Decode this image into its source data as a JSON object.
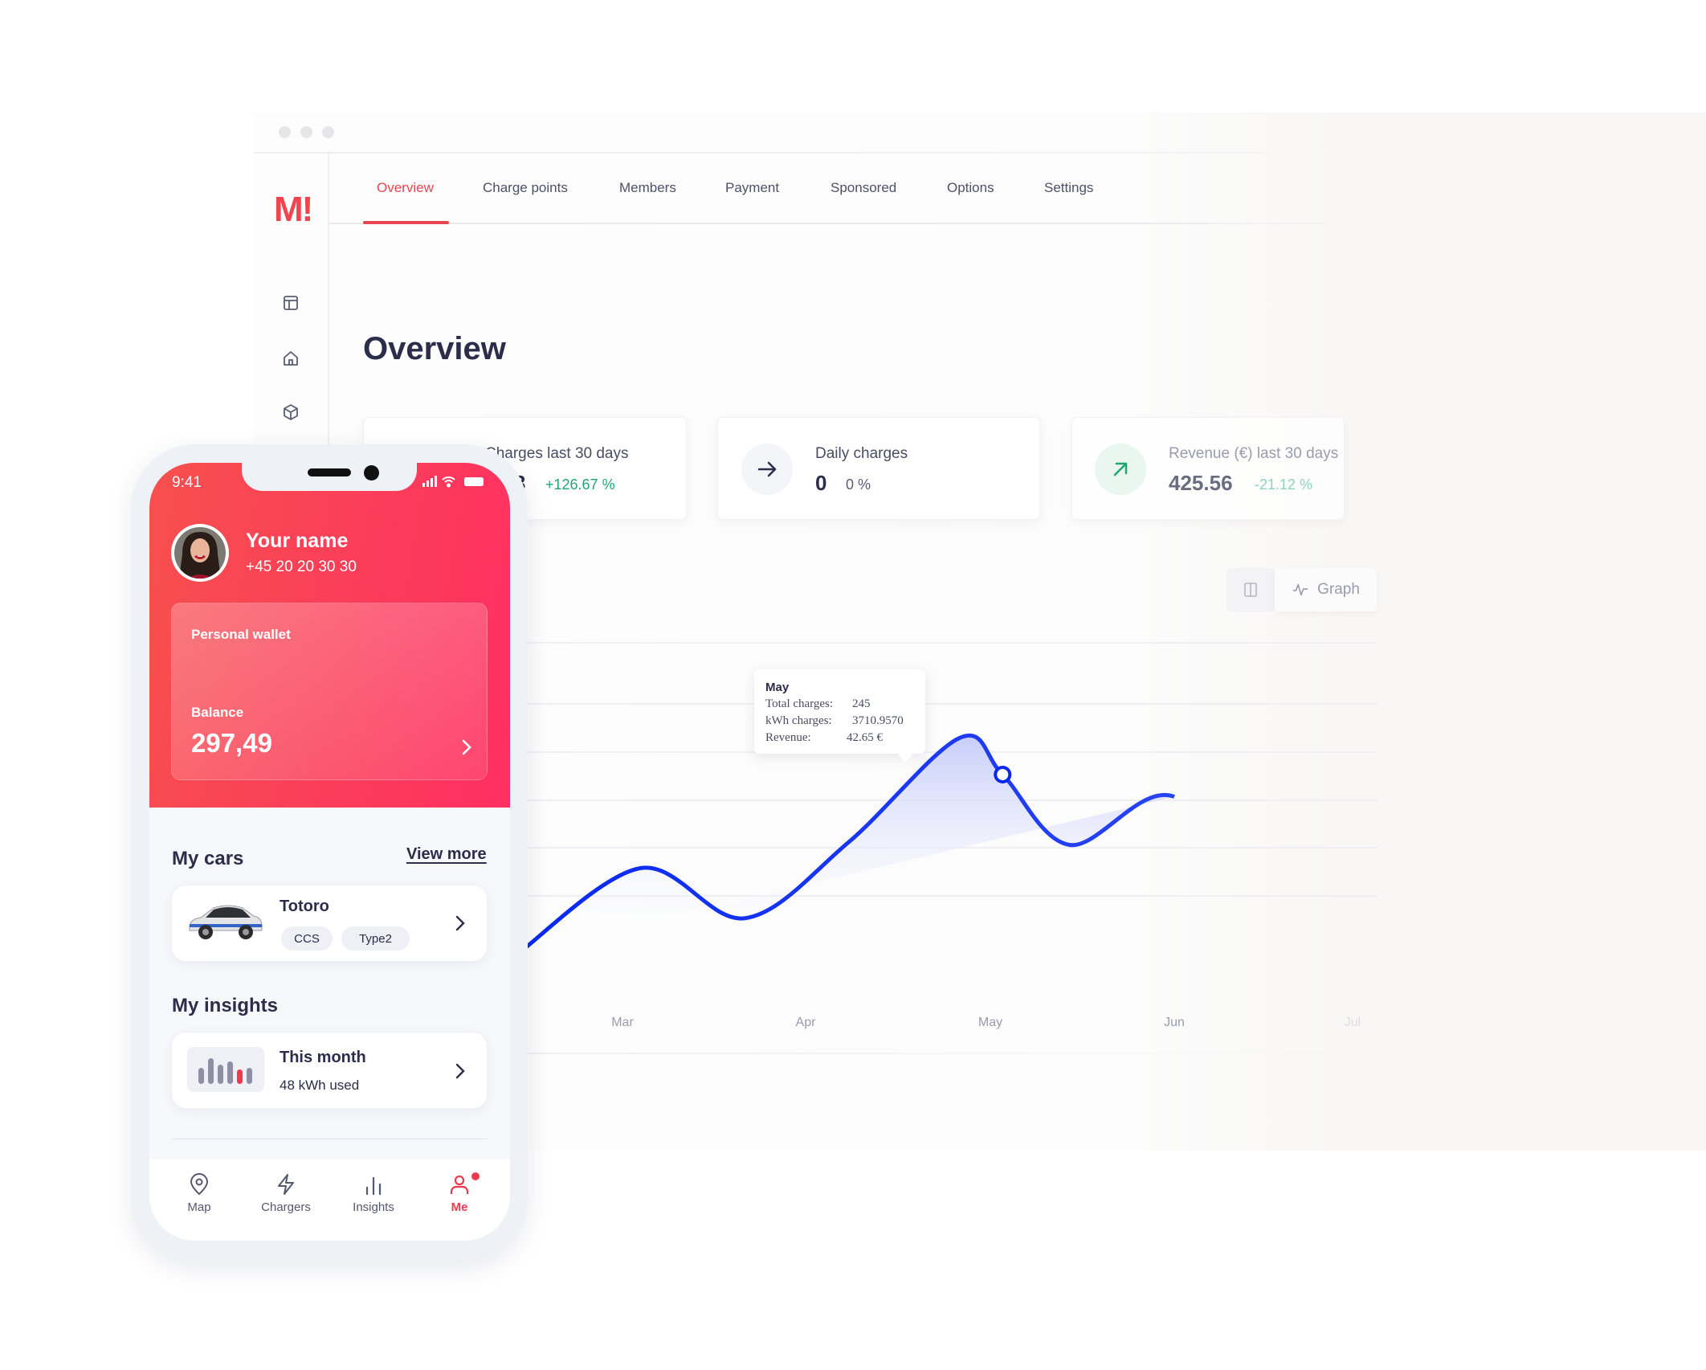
{
  "colors": {
    "accent": "#e8464f",
    "line": "#0a29f0",
    "positive": "#1ea672",
    "text": "#2b2d4a"
  },
  "dashboard": {
    "logo": "M!",
    "sidebar_icons": [
      "layout-icon",
      "home-icon",
      "box-icon"
    ],
    "tabs": [
      {
        "label": "Overview",
        "active": true
      },
      {
        "label": "Charge points"
      },
      {
        "label": "Members"
      },
      {
        "label": "Payment"
      },
      {
        "label": "Sponsored"
      },
      {
        "label": "Options"
      },
      {
        "label": "Settings"
      }
    ],
    "page_title": "Overview",
    "stats": [
      {
        "label": "Charges last 30 days",
        "value": "3",
        "change": "+126.67 %"
      },
      {
        "label": "Daily charges",
        "value": "0",
        "change": "0 %",
        "icon": "arrow-right-icon"
      },
      {
        "label": "Revenue (€) last 30 days",
        "value": "425.56",
        "change": "-21.12 %",
        "icon": "arrow-up-right-icon"
      }
    ],
    "view_toggle": {
      "table_icon": "columns-icon",
      "graph_label": "Graph"
    },
    "tooltip": {
      "title": "May",
      "rows": [
        {
          "k": "Total charges:",
          "v": "245"
        },
        {
          "k": "kWh charges:",
          "v": "3710.9570"
        },
        {
          "k": "Revenue:",
          "v": "42.65 €"
        }
      ]
    }
  },
  "chart_data": {
    "type": "area",
    "x_ticks": [
      "Mar",
      "Apr",
      "May",
      "Jun",
      "Jul"
    ],
    "x": [
      "Feb 14",
      "Mar 4",
      "Mar 21",
      "Apr 8",
      "Apr 26",
      "May 3",
      "May 14",
      "Jun 1",
      "Jun 18",
      "Jul 2"
    ],
    "values": [
      60,
      148,
      96,
      175,
      283,
      245,
      172,
      222,
      88,
      168
    ],
    "highlight": {
      "x": "May 3",
      "value": 245
    },
    "grid": true,
    "ylim": [
      0,
      380
    ]
  },
  "phone": {
    "time": "9:41",
    "user": {
      "name": "Your name",
      "phone": "+45 20 20 30 30"
    },
    "wallet": {
      "title": "Personal wallet",
      "balance_label": "Balance",
      "balance": "297,49"
    },
    "cars": {
      "title": "My cars",
      "view_more": "View more",
      "items": [
        {
          "name": "Totoro",
          "chips": [
            "CCS",
            "Type2"
          ]
        }
      ]
    },
    "insights": {
      "title": "My insights",
      "items": [
        {
          "title": "This month",
          "subtitle": "48 kWh used"
        }
      ]
    },
    "nav": [
      {
        "label": "Map",
        "icon": "map-pin-icon"
      },
      {
        "label": "Chargers",
        "icon": "lightning-icon"
      },
      {
        "label": "Insights",
        "icon": "bar-chart-icon"
      },
      {
        "label": "Me",
        "icon": "user-icon",
        "active": true,
        "badge": true
      }
    ]
  }
}
